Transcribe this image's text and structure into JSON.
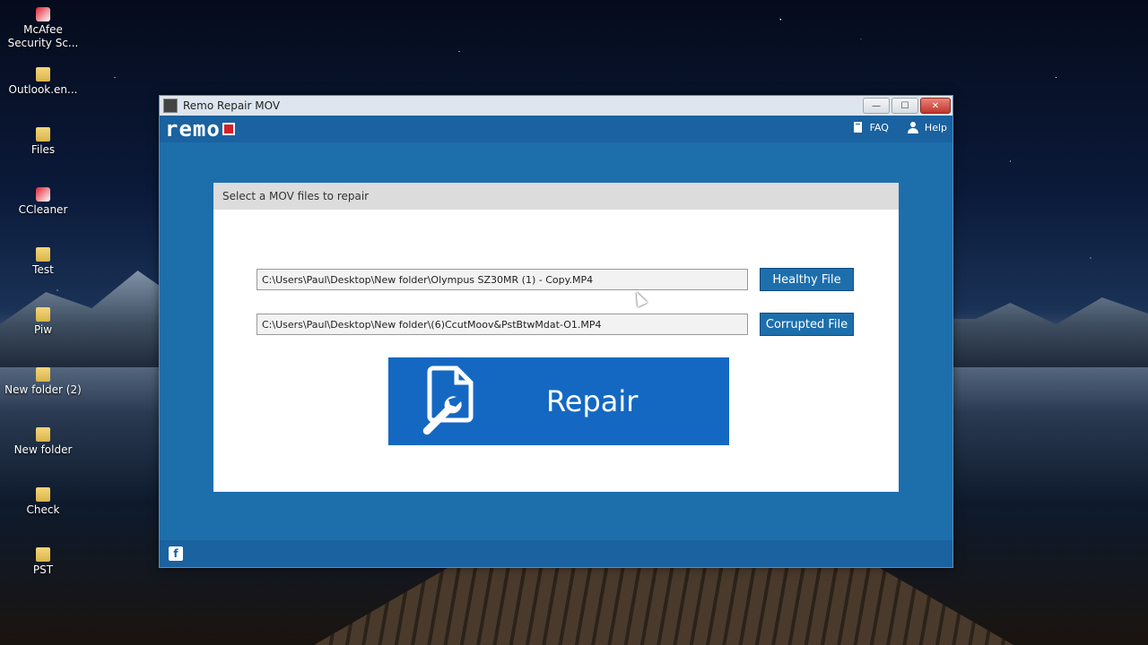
{
  "desktop": {
    "icons": [
      {
        "label": "McAfee Security Sc...",
        "type": "app"
      },
      {
        "label": "Outlook.en...",
        "type": "folder"
      },
      {
        "label": "Files",
        "type": "folder"
      },
      {
        "label": "CCleaner",
        "type": "app"
      },
      {
        "label": "Test",
        "type": "folder"
      },
      {
        "label": "Piw",
        "type": "folder"
      },
      {
        "label": "New folder (2)",
        "type": "folder"
      },
      {
        "label": "New folder",
        "type": "folder"
      },
      {
        "label": "Check",
        "type": "folder"
      },
      {
        "label": "PST",
        "type": "folder"
      }
    ]
  },
  "window": {
    "title": "Remo Repair MOV",
    "controls": {
      "minimize": "—",
      "maximize": "☐",
      "close": "✕"
    }
  },
  "appbar": {
    "logo": "remo",
    "faq_label": "FAQ",
    "help_label": "Help"
  },
  "panel": {
    "heading": "Select a MOV files to repair",
    "healthy_path": "C:\\Users\\Paul\\Desktop\\New folder\\Olympus SZ30MR (1) - Copy.MP4",
    "corrupted_path": "C:\\Users\\Paul\\Desktop\\New folder\\(6)CcutMoov&PstBtwMdat-O1.MP4",
    "healthy_button": "Healthy File",
    "corrupted_button": "Corrupted File",
    "repair_button": "Repair"
  },
  "footer": {
    "facebook": "f"
  },
  "colors": {
    "window_blue": "#1d6fac",
    "repair_blue": "#1468c2",
    "logo_red": "#d4202a"
  }
}
